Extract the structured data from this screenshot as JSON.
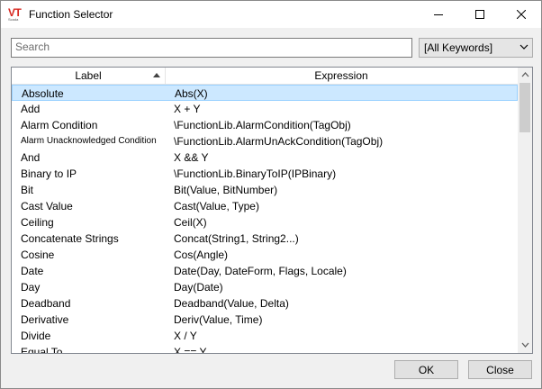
{
  "window": {
    "title": "Function Selector",
    "logo_text": "VT",
    "logo_sub": "Scada"
  },
  "search": {
    "placeholder": "Search",
    "value": ""
  },
  "keyword_filter": {
    "selected": "[All Keywords]"
  },
  "table": {
    "columns": [
      "Label",
      "Expression"
    ],
    "sort_column": "Label",
    "sort_direction": "ascending",
    "selected_index": 0,
    "rows": [
      {
        "label": "Absolute",
        "expr": "Abs(X)"
      },
      {
        "label": "Add",
        "expr": "X + Y"
      },
      {
        "label": "Alarm Condition",
        "expr": "\\FunctionLib.AlarmCondition(TagObj)"
      },
      {
        "label": "Alarm Unacknowledged Condition",
        "expr": "\\FunctionLib.AlarmUnAckCondition(TagObj)"
      },
      {
        "label": "And",
        "expr": "X && Y"
      },
      {
        "label": "Binary to IP",
        "expr": "\\FunctionLib.BinaryToIP(IPBinary)"
      },
      {
        "label": "Bit",
        "expr": "Bit(Value, BitNumber)"
      },
      {
        "label": "Cast Value",
        "expr": "Cast(Value, Type)"
      },
      {
        "label": "Ceiling",
        "expr": "Ceil(X)"
      },
      {
        "label": "Concatenate Strings",
        "expr": "Concat(String1, String2...)"
      },
      {
        "label": "Cosine",
        "expr": "Cos(Angle)"
      },
      {
        "label": "Date",
        "expr": "Date(Day, DateForm, Flags, Locale)"
      },
      {
        "label": "Day",
        "expr": "Day(Date)"
      },
      {
        "label": "Deadband",
        "expr": "Deadband(Value, Delta)"
      },
      {
        "label": "Derivative",
        "expr": "Deriv(Value, Time)"
      },
      {
        "label": "Divide",
        "expr": "X / Y"
      },
      {
        "label": "Equal To",
        "expr": "X == Y"
      }
    ]
  },
  "buttons": {
    "ok": "OK",
    "close": "Close"
  },
  "colors": {
    "selection_bg": "#cce8ff",
    "selection_border": "#99d1ff",
    "logo_red": "#d7261e"
  }
}
